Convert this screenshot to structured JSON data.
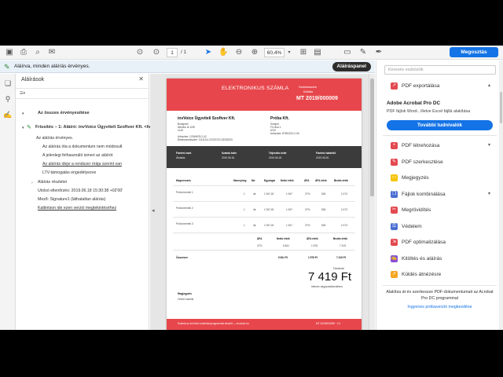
{
  "toolbar": {
    "page_current": "1",
    "page_total": "/ 1",
    "zoom": "60,4%",
    "share_label": "Megosztás"
  },
  "signature_bar": {
    "status_text": "Aláírva, minden aláírás érvényes.",
    "panel_button": "Aláíráspanel"
  },
  "signatures_panel": {
    "title": "Aláírások",
    "verify_all": "Az összes érvényesítése",
    "signature_title": "Frissítés – 1: Aláíró: invVoice Ügyviteli Szoftver Kft. <helloInv",
    "lines": [
      "Az aláírás érvényes.",
      "Az aláírás óta a dokumentum nem módosult",
      "A jelenlegi felhasználó ismeri az aláírót",
      "Az aláírás ideje a rendszer órája szerint van",
      "LTV-támogatás engedélyezve",
      "Aláírás részletei",
      "Utolsó ellenőrzés: 2019.06.18 15:30:38 +02'00'",
      "Mező: Signature1 (láthatatlan aláírás)",
      "Kattintson ide ezen verzió megtekintéséhez"
    ]
  },
  "invoice": {
    "title": "ELEKTRONIKUS SZÁMLA",
    "number_label": "Számlaszám",
    "date_label": "Kiállítás",
    "number": "MT 2019/000009",
    "seller_name": "invVoice Ügyviteli Szoftver Kft.",
    "seller_lines": [
      "Budapest",
      "Mexikói út 12/B",
      "1145",
      "",
      "Adószám: 12345678-2-42",
      "Bankszámlaszám: 11111111-22222222-33333333"
    ],
    "buyer_name": "Próba Kft.",
    "buyer_lines": [
      "Szeged",
      "Fő utca 1.",
      "6720",
      "Adószám: 87654321-2-06"
    ],
    "band_headers": [
      "Fizetési mód",
      "Számla kelte",
      "Teljesítés kelte",
      "Fizetési határidő"
    ],
    "band_values": [
      "Átutalás",
      "2019.06.18.",
      "2019.06.18.",
      "2019.06.26."
    ],
    "table_headers": [
      "Megnevezés",
      "Mennyiség",
      "Me",
      "Egységár",
      "Nettó érték",
      "ÁFA",
      "ÁFA érték",
      "Bruttó érték"
    ],
    "items": [
      {
        "name": "Próba termék 1",
        "qty": "1",
        "unit": "db",
        "price": "1 947,00",
        "net": "1 947",
        "vat": "27%",
        "vat_amt": "526",
        "gross": "2 473"
      },
      {
        "name": "Próba termék 2",
        "qty": "1",
        "unit": "db",
        "price": "1 947,00",
        "net": "1 947",
        "vat": "27%",
        "vat_amt": "526",
        "gross": "2 473"
      },
      {
        "name": "Próba termék 3",
        "qty": "1",
        "unit": "db",
        "price": "1 947,00",
        "net": "1 947",
        "vat": "27%",
        "vat_amt": "526",
        "gross": "2 473"
      }
    ],
    "summary_headers": [
      "ÁFA",
      "Nettó érték",
      "ÁFA érték",
      "Bruttó érték"
    ],
    "summary_row": [
      "27%",
      "5 841",
      "1 578",
      "7 419"
    ],
    "total_label": "Összesen",
    "total_row": [
      "5 841 Ft",
      "1 578 Ft",
      "7 419 Ft"
    ],
    "amount_label": "Fizetendő",
    "amount": "7 419 Ft",
    "amount_words": "hétezer-négyszáztizenkilenc",
    "note_label": "Megjegyzés",
    "note": "Online számla",
    "footer_text": "Számla az invVoice számlázóprogrammal készült — invvoice.hu",
    "footer_num": "MT 2019/000009 · 1/1"
  },
  "tools_panel": {
    "search_placeholder": "Keresés eszközök",
    "export_label": "PDF exportálása",
    "promo_title": "Adobe Acrobat Pro DC",
    "promo_desc": "PDF fájlok Word-, illetve Excel fájllá alakítása",
    "promo_button": "További tudnivalók",
    "tools": [
      {
        "label": "PDF létrehozása",
        "icon": "create-pdf-icon",
        "color": "#e34850",
        "chev": true
      },
      {
        "label": "PDF szerkesztése",
        "icon": "edit-pdf-icon",
        "color": "#e34850",
        "chev": false
      },
      {
        "label": "Megjegyzés",
        "icon": "comment-icon",
        "color": "#f5c400",
        "chev": false
      },
      {
        "label": "Fájlok kombinálása",
        "icon": "combine-files-icon",
        "color": "#4b6fd1",
        "chev": true
      },
      {
        "label": "Megrövidítés",
        "icon": "redact-icon",
        "color": "#e34850",
        "chev": false
      },
      {
        "label": "Védelem",
        "icon": "protect-icon",
        "color": "#4b6fd1",
        "chev": false
      },
      {
        "label": "PDF optimalizálása",
        "icon": "optimize-pdf-icon",
        "color": "#e34850",
        "chev": false
      },
      {
        "label": "Kitöltés és aláírás",
        "icon": "fill-sign-icon",
        "color": "#8a4fd1",
        "chev": false
      },
      {
        "label": "Küldés átnézésre",
        "icon": "send-review-icon",
        "color": "#f5a623",
        "chev": false
      }
    ],
    "bottom_text": "Alakítsa át és szerkessze PDF-dokumentumait az Acrobat Pro DC programmal",
    "bottom_link": "Ingyenes próbaverzió megkezdése"
  }
}
